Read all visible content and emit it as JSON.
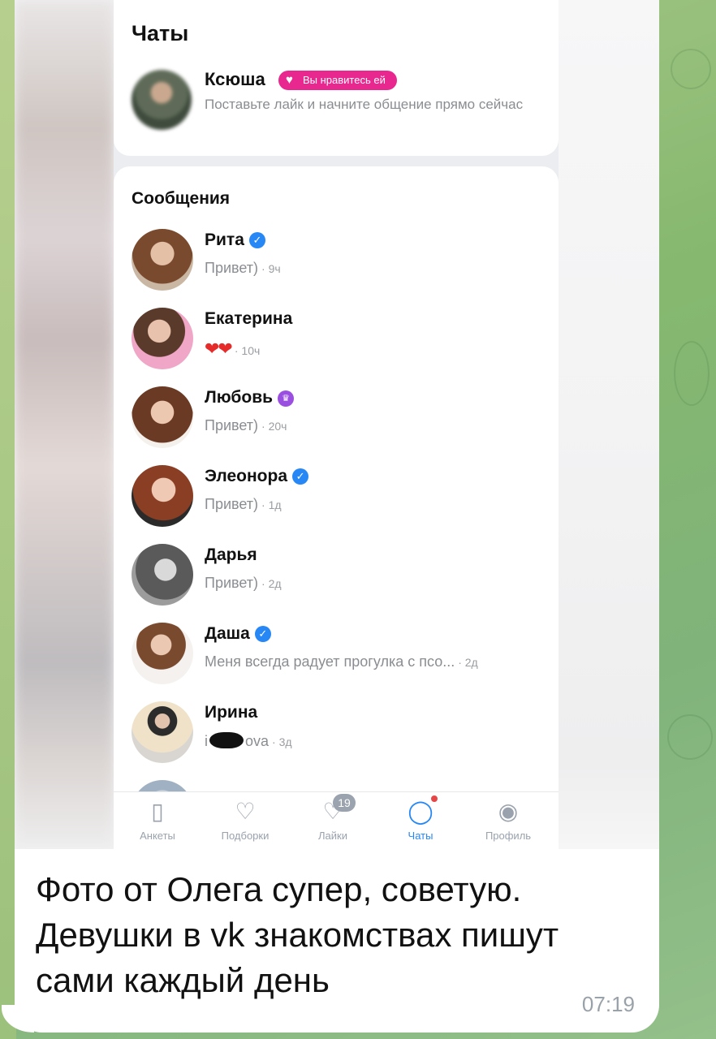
{
  "screen": {
    "title": "Чаты",
    "like_card": {
      "name": "Ксюша",
      "badge": "Вы нравитесь ей",
      "subtitle": "Поставьте лайк и начните общение прямо сейчас"
    },
    "section_title": "Сообщения",
    "chats": [
      {
        "name": "Рита",
        "badge": "verified",
        "message": "Привет)",
        "time": "· 9ч"
      },
      {
        "name": "Екатерина",
        "badge": "",
        "message": "❤❤",
        "time": "· 10ч"
      },
      {
        "name": "Любовь",
        "badge": "crown",
        "message": "Привет)",
        "time": "· 20ч"
      },
      {
        "name": "Элеонора",
        "badge": "verified",
        "message": "Привет)",
        "time": "· 1д"
      },
      {
        "name": "Дарья",
        "badge": "",
        "message": "Привет)",
        "time": "· 2д"
      },
      {
        "name": "Даша",
        "badge": "verified",
        "message": "Меня всегда радует прогулка с псо...",
        "time": "· 2д"
      },
      {
        "name": "Ирина",
        "badge": "",
        "message_prefix": "i",
        "message_suffix": "ova",
        "time": "· 3д"
      }
    ],
    "tabs": [
      {
        "label": "Анкеты",
        "icon": "cards-icon"
      },
      {
        "label": "Подборки",
        "icon": "heart-search-icon"
      },
      {
        "label": "Лайки",
        "icon": "heart-icon",
        "count": "19"
      },
      {
        "label": "Чаты",
        "icon": "chat-bubble-icon",
        "active": true
      },
      {
        "label": "Профиль",
        "icon": "profile-icon"
      }
    ]
  },
  "message": {
    "caption_lines": [
      "Фото от Олега супер, советую.",
      "Девушки в vk знакомствах пишут",
      "сами каждый день"
    ],
    "time": "07:19"
  },
  "colors": {
    "accent": "#2787f5",
    "like_badge": "#e8278f",
    "crown": "#9b4fe0",
    "wallpaper": "#86b86f"
  }
}
